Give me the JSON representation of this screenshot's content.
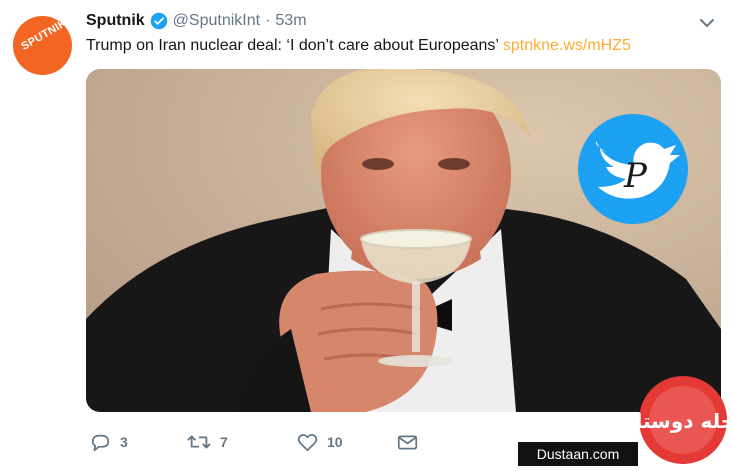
{
  "tweet": {
    "author_name": "Sputnik",
    "author_handle": "@SputnikInt",
    "separator": "·",
    "time": "53m",
    "avatar_text": "SPUTNIK",
    "text": "Trump on Iran nuclear deal: ‘I don’t care about Europeans’",
    "link": "sptnkne.ws/mHZ5",
    "verified": true
  },
  "actions": {
    "replies": "3",
    "retweets": "7",
    "likes": "10"
  },
  "watermark": {
    "site": "Dustaan.com",
    "logo_text": "مجله دوستان"
  },
  "colors": {
    "link": "#ffac33",
    "verified": "#1da1f2",
    "twitter_blue": "#1da1f2",
    "sputnik_orange": "#f26522",
    "watermark_red": "#e53935"
  },
  "icons": [
    "verified-badge-icon",
    "chevron-down-icon",
    "reply-icon",
    "retweet-icon",
    "like-icon",
    "message-icon",
    "twitter-bird-icon"
  ]
}
